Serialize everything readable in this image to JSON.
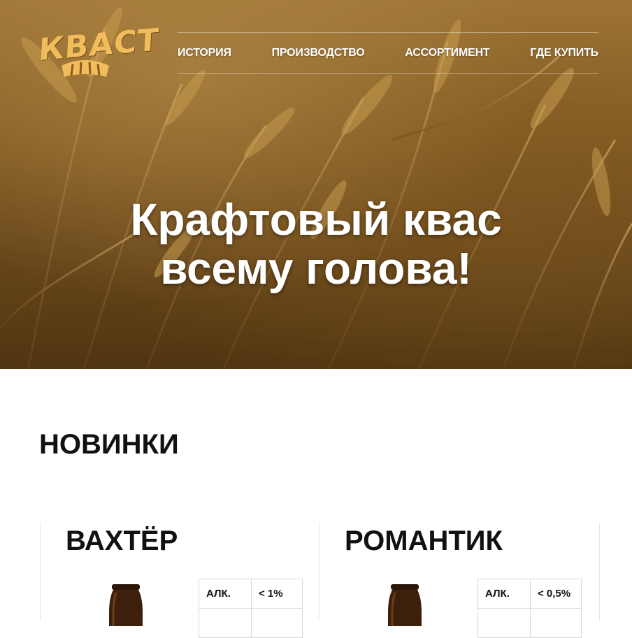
{
  "header": {
    "logo_text": "КВАСТ",
    "nav": [
      {
        "label": "ИСТОРИЯ"
      },
      {
        "label": "ПРОИЗВОДСТВО"
      },
      {
        "label": "АССОРТИМЕНТ"
      },
      {
        "label": "ГДЕ КУПИТЬ"
      }
    ]
  },
  "hero": {
    "title_line1": "Крафтовый квас",
    "title_line2": "всему голова!"
  },
  "new_products": {
    "heading": "НОВИНКИ",
    "items": [
      {
        "name": "ВАХТЁР",
        "spec_label": "АЛК.",
        "spec_value": "< 1%"
      },
      {
        "name": "РОМАНТИК",
        "spec_label": "АЛК.",
        "spec_value": "< 0,5%"
      }
    ]
  },
  "colors": {
    "logo": "#f1bd5c",
    "hero_dark": "#5a3c14",
    "hero_light": "#b8893f",
    "text": "#111111"
  },
  "icons": {
    "logo_emblem": "bread-loaves-icon",
    "product_image": "bottle-icon"
  }
}
